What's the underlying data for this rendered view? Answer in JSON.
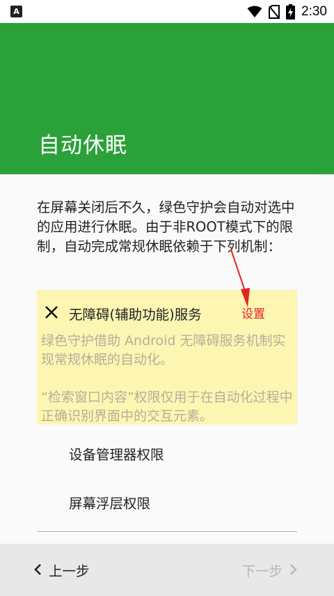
{
  "status_bar": {
    "app_icon": "A",
    "time": "2:30"
  },
  "app_bar": {
    "title": "自动休眠"
  },
  "intro_text": "在屏幕关闭后不久，绿色守护会自动对选中的应用进行休眠。由于非ROOT模式下的限制，自动完成常规休眠依赖于下列机制：",
  "accessibility_card": {
    "title": "无障碍(辅助功能)服务",
    "description_1": "绿色守护借助 Android 无障碍服务机制实现常规休眠的自动化。",
    "description_2": "“检索窗口内容”权限仅用于在自动化过程中正确识别界面中的交互元素。",
    "status_icon": "close-icon",
    "background_color": "#fdf5b2"
  },
  "annotation": {
    "label": "设置",
    "color": "#e82020"
  },
  "permissions": [
    {
      "label": "设备管理器权限"
    },
    {
      "label": "屏幕浮层权限"
    }
  ],
  "bottom_nav": {
    "back_label": "上一步",
    "next_label": "下一步"
  },
  "colors": {
    "app_bar": "#2ba13a",
    "disabled_text": "#b8b8b8"
  }
}
